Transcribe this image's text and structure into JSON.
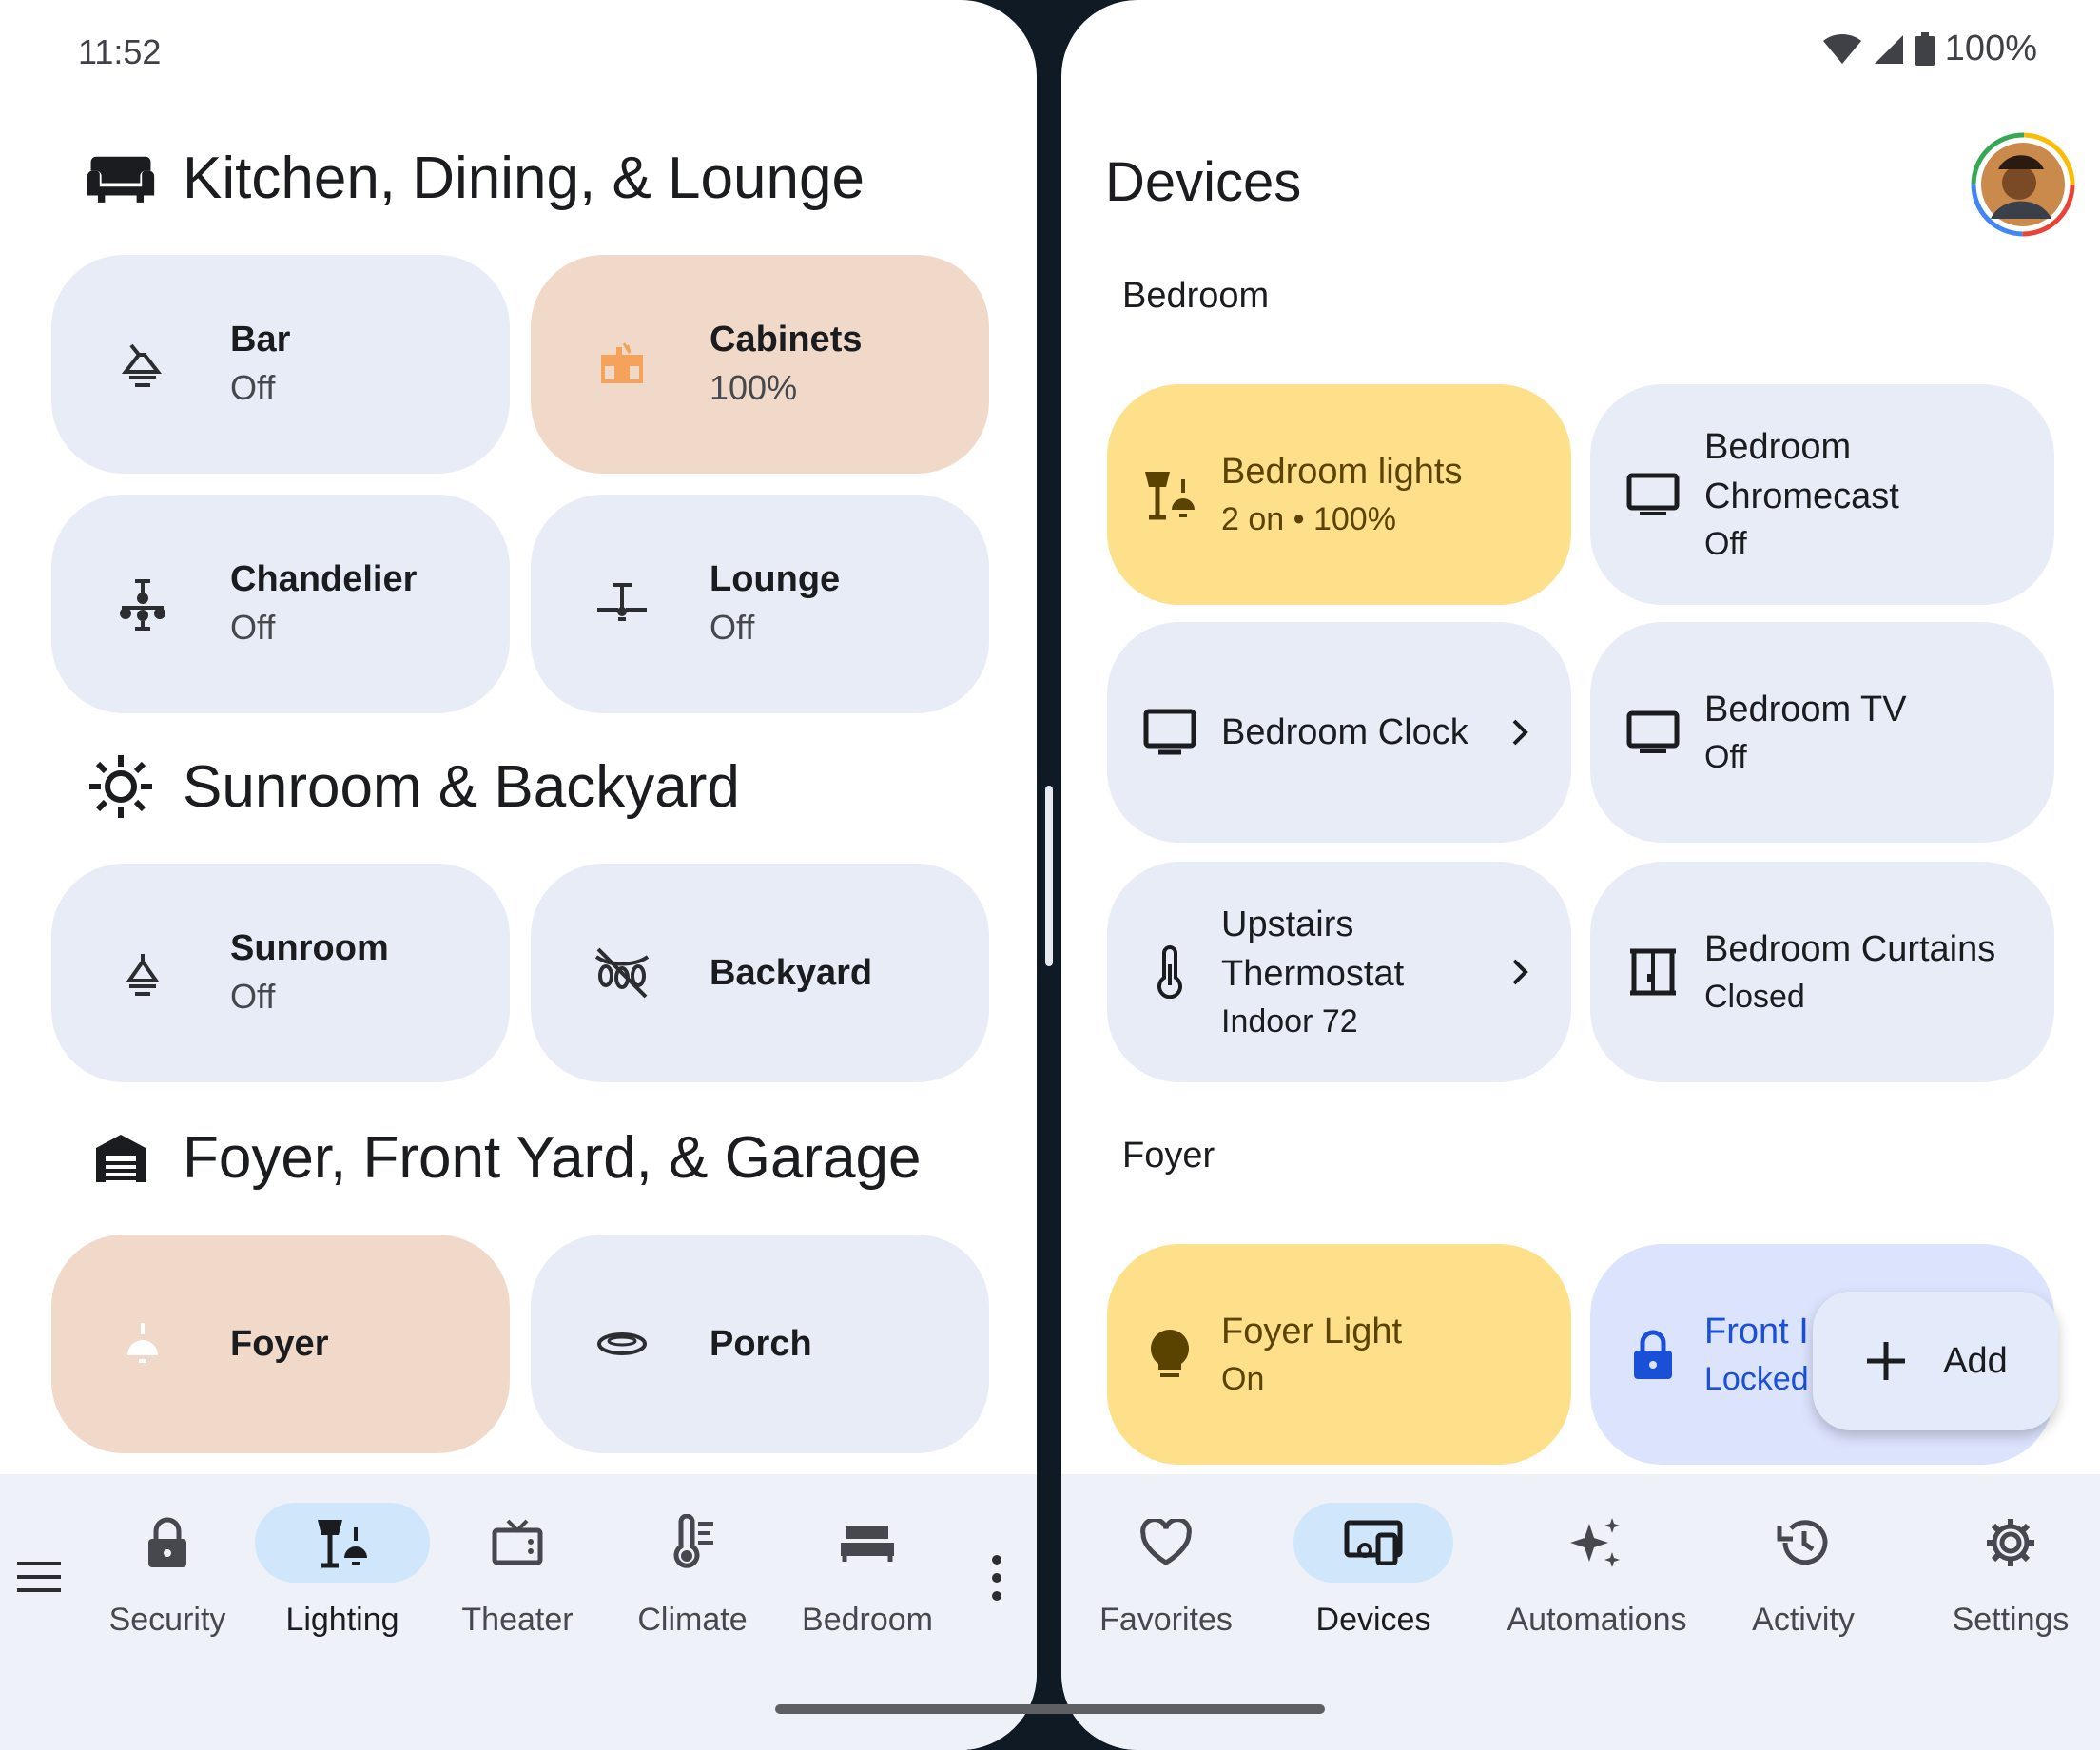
{
  "status": {
    "time": "11:52",
    "battery": "100%"
  },
  "left": {
    "sections": [
      {
        "title": "Kitchen, Dining, & Lounge",
        "icon": "sofa-icon"
      },
      {
        "title": "Sunroom & Backyard",
        "icon": "sun-icon"
      },
      {
        "title": "Foyer, Front Yard, & Garage",
        "icon": "garage-icon"
      }
    ],
    "tiles": [
      {
        "name": "Bar",
        "state": "Off",
        "icon": "pendant-lamp-icon"
      },
      {
        "name": "Cabinets",
        "state": "100%",
        "icon": "cabinet-light-icon"
      },
      {
        "name": "Chandelier",
        "state": "Off",
        "icon": "chandelier-icon"
      },
      {
        "name": "Lounge",
        "state": "Off",
        "icon": "ceiling-fan-light-icon"
      },
      {
        "name": "Sunroom",
        "state": "Off",
        "icon": "lamp-icon"
      },
      {
        "name": "Backyard",
        "state": "",
        "icon": "string-lights-off-icon"
      },
      {
        "name": "Foyer",
        "state": "",
        "icon": "ceiling-lamp-icon"
      },
      {
        "name": "Porch",
        "state": "",
        "icon": "flush-mount-light-icon"
      }
    ],
    "nav": [
      {
        "label": "Security",
        "icon": "lock-icon"
      },
      {
        "label": "Lighting",
        "icon": "lighting-icon"
      },
      {
        "label": "Theater",
        "icon": "tv-icon"
      },
      {
        "label": "Climate",
        "icon": "thermostat-icon"
      },
      {
        "label": "Bedroom",
        "icon": "bed-icon"
      }
    ]
  },
  "right": {
    "title": "Devices",
    "groups": [
      {
        "title": "Bedroom"
      },
      {
        "title": "Foyer"
      }
    ],
    "devices": [
      {
        "name": "Bedroom lights",
        "state": "2 on • 100%",
        "icon": "lamps-icon"
      },
      {
        "name": "Bedroom Chromecast",
        "state": "Off",
        "icon": "display-icon"
      },
      {
        "name": "Bedroom Clock",
        "state": "",
        "icon": "monitor-icon"
      },
      {
        "name": "Bedroom TV",
        "state": "Off",
        "icon": "display-icon"
      },
      {
        "name": "Upstairs Thermostat",
        "state": "Indoor 72",
        "icon": "thermometer-icon"
      },
      {
        "name": "Bedroom Curtains",
        "state": "Closed",
        "icon": "curtains-icon"
      },
      {
        "name": "Foyer Light",
        "state": "On",
        "icon": "bulb-icon"
      },
      {
        "name": "Front I",
        "state": "Locked",
        "icon": "lock-icon"
      }
    ],
    "fab": {
      "label": "Add"
    },
    "nav": [
      {
        "label": "Favorites",
        "icon": "heart-icon"
      },
      {
        "label": "Devices",
        "icon": "devices-icon"
      },
      {
        "label": "Automations",
        "icon": "sparkle-icon"
      },
      {
        "label": "Activity",
        "icon": "history-icon"
      },
      {
        "label": "Settings",
        "icon": "gear-icon"
      }
    ]
  },
  "colors": {
    "tile": "#e7ecf6",
    "warm": "#f0d9c8",
    "yellow": "#fde089",
    "lilac": "#dce3fd",
    "accent_pill": "#cfe6fb"
  }
}
